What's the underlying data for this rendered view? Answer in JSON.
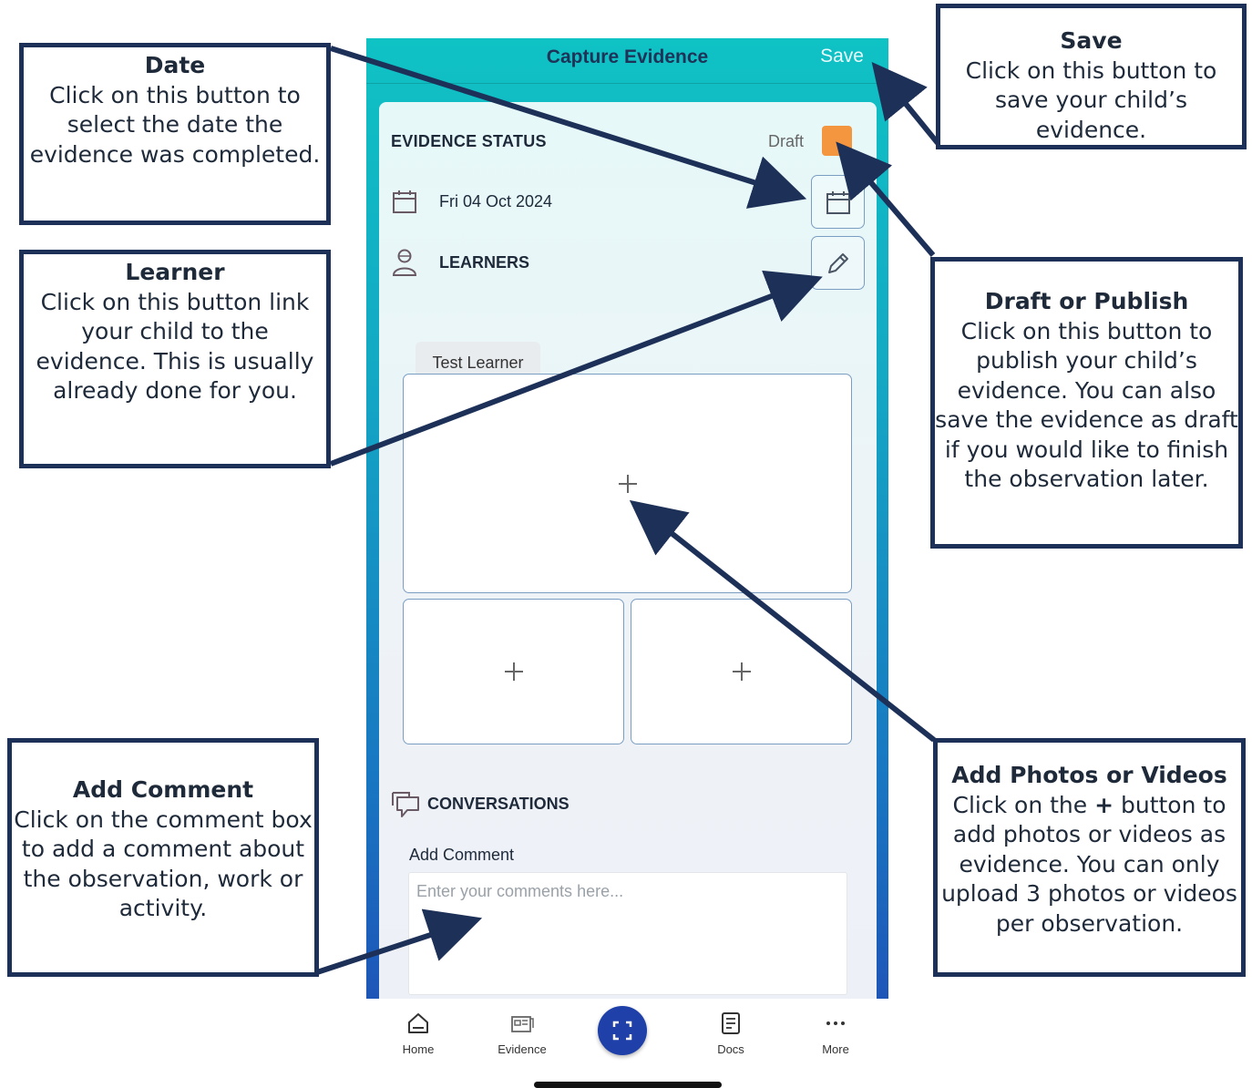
{
  "app": {
    "title": "Capture Evidence",
    "save_label": "Save"
  },
  "evidence_status": {
    "label": "EVIDENCE STATUS",
    "value": "Draft",
    "toggle_color": "#f4963f"
  },
  "date": {
    "value": "Fri 04 Oct 2024"
  },
  "learners": {
    "label": "LEARNERS",
    "items": [
      "Test  Learner"
    ]
  },
  "media": {
    "slots": [
      "+",
      "+",
      "+"
    ]
  },
  "conversations": {
    "label": "CONVERSATIONS",
    "comment_label": "Add Comment",
    "comment_placeholder": "Enter your comments here...",
    "comment_value": ""
  },
  "bottom_nav": {
    "items": [
      {
        "label": "Home",
        "icon": "home-icon"
      },
      {
        "label": "Evidence",
        "icon": "evidence-icon"
      },
      {
        "label": "",
        "icon": "scan-icon"
      },
      {
        "label": "Docs",
        "icon": "docs-icon"
      },
      {
        "label": "More",
        "icon": "more-dots-icon"
      }
    ]
  },
  "callouts": {
    "date": {
      "title": "Date",
      "body": "Click on this button to select the date the evidence was completed."
    },
    "learner": {
      "title": "Learner",
      "body": "Click on this button link your child to the evidence. This is usually already done for you."
    },
    "comment": {
      "title": "Add Comment",
      "body": "Click on the comment box to add a comment about the observation, work or activity."
    },
    "save": {
      "title": "Save",
      "body": "Click on this button to save your child’s evidence."
    },
    "draft": {
      "title": "Draft or Publish",
      "body": "Click on this button to publish your child’s evidence. You can also save the evidence as draft if you would like to finish the observation later."
    },
    "photos": {
      "title": "Add Photos or Videos",
      "body_prefix": "Click on the ",
      "body_plus": "+",
      "body_rest": " button to add photos or videos as evidence. You can only upload 3 photos or videos per observation."
    }
  },
  "colors": {
    "callout_border": "#1d3058",
    "arrow": "#1d3058",
    "header_teal": "#0fc2c4",
    "nav_blue": "#1e55b8",
    "scan_button": "#1e40a8"
  }
}
